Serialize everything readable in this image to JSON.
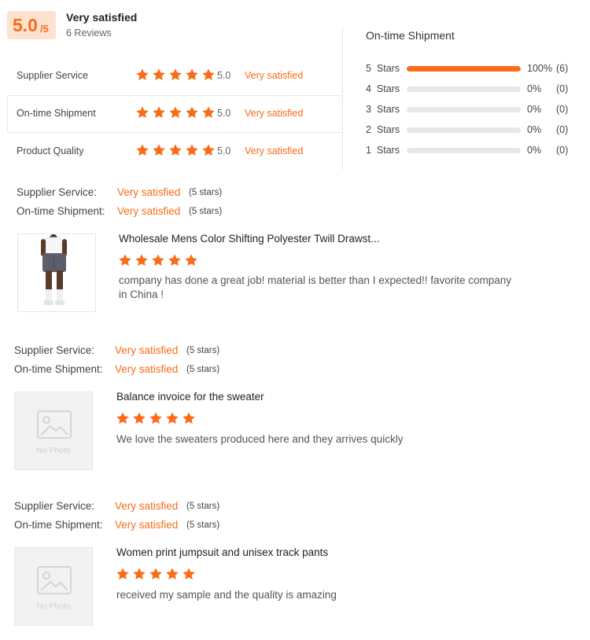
{
  "summary": {
    "score": "5.0",
    "score_max": "/5",
    "satisfaction": "Very satisfied",
    "reviews_count": "6 Reviews"
  },
  "categories": [
    {
      "label": "Supplier Service",
      "score": "5.0",
      "satisfaction": "Very satisfied",
      "stars": 5
    },
    {
      "label": "On-time Shipment",
      "score": "5.0",
      "satisfaction": "Very satisfied",
      "stars": 5
    },
    {
      "label": "Product Quality",
      "score": "5.0",
      "satisfaction": "Very satisfied",
      "stars": 5
    }
  ],
  "distribution": {
    "title": "On-time Shipment",
    "rows": [
      {
        "label": "5  Stars",
        "percent": "100%",
        "count": "(6)",
        "fraction": 1.0
      },
      {
        "label": "4  Stars",
        "percent": "0%",
        "count": "(0)",
        "fraction": 0
      },
      {
        "label": "3  Stars",
        "percent": "0%",
        "count": "(0)",
        "fraction": 0
      },
      {
        "label": "2  Stars",
        "percent": "0%",
        "count": "(0)",
        "fraction": 0
      },
      {
        "label": "1  Stars",
        "percent": "0%",
        "count": "(0)",
        "fraction": 0
      }
    ]
  },
  "reviews": [
    {
      "supplier_label": "Supplier Service:",
      "supplier_value": "Very satisfied",
      "supplier_stars": "(5 stars)",
      "shipment_label": "On-time Shipment:",
      "shipment_value": "Very satisfied",
      "shipment_stars": "(5 stars)",
      "product_title": "Wholesale Mens Color Shifting Polyester Twill Drawst...",
      "rating": 5,
      "text": "company has done a great job! material is better than I expected!! favorite company in China !",
      "image": "product-photo"
    },
    {
      "supplier_label": "Supplier Service:",
      "supplier_value": "Very satisfied",
      "supplier_stars": "(5 stars)",
      "shipment_label": "On-time Shipment:",
      "shipment_value": "Very satisfied",
      "shipment_stars": "(5 stars)",
      "product_title": "Balance invoice for the sweater",
      "rating": 5,
      "text": "We love the sweaters produced here and they arrives quickly",
      "image": "no-photo",
      "placeholder_text": "No Photo"
    },
    {
      "supplier_label": "Supplier Service:",
      "supplier_value": "Very satisfied",
      "supplier_stars": "(5 stars)",
      "shipment_label": "On-time Shipment:",
      "shipment_value": "Very satisfied",
      "shipment_stars": "(5 stars)",
      "product_title": "Women print jumpsuit and unisex track pants",
      "rating": 5,
      "text": "received my sample and the quality is amazing",
      "image": "no-photo",
      "placeholder_text": "No Photo"
    }
  ],
  "colors": {
    "accent": "#f96c1a",
    "accent_light": "#fde2d0",
    "bar_empty": "#e8e8e8"
  }
}
